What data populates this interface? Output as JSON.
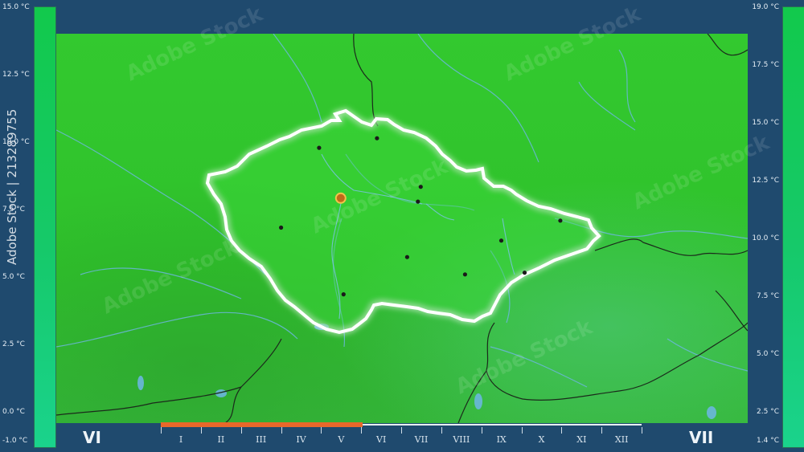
{
  "left_scale": {
    "ticks": [
      "15.0 °C",
      "12.5 °C",
      "10.0 °C",
      "7.5 °C",
      "5.0 °C",
      "2.5 °C",
      "0.0 °C",
      "-1.0 °C"
    ],
    "min": -1.0,
    "max": 15.0
  },
  "right_scale": {
    "ticks": [
      "19.0 °C",
      "17.5 °C",
      "15.0 °C",
      "12.5 °C",
      "10.0 °C",
      "7.5 °C",
      "5.0 °C",
      "2.5 °C",
      "1.4 °C"
    ],
    "min": 1.4,
    "max": 19.0
  },
  "month_left": "VI",
  "month_right": "VII",
  "timeline": {
    "months": [
      "I",
      "II",
      "III",
      "IV",
      "V",
      "VI",
      "VII",
      "VIII",
      "IX",
      "X",
      "XI",
      "XII"
    ],
    "progress_fraction": 0.42
  },
  "watermark": {
    "stock_id": "213289755",
    "brand": "Adobe Stock"
  },
  "colors": {
    "frame": "#1f4a6e",
    "map_green": "#33c92f",
    "legend_green": "#16c96a",
    "progress": "#e8682a",
    "border_glow": "#ffffff"
  },
  "cities": [
    {
      "name": "capital",
      "lon": 14.42,
      "lat": 50.08,
      "capital": true
    },
    {
      "name": "city-1",
      "lon": 13.37,
      "lat": 49.74
    },
    {
      "name": "city-2",
      "lon": 14.47,
      "lat": 48.97
    },
    {
      "name": "city-3",
      "lon": 16.61,
      "lat": 49.2
    },
    {
      "name": "city-4",
      "lon": 18.29,
      "lat": 49.82
    },
    {
      "name": "city-5",
      "lon": 17.25,
      "lat": 49.59
    },
    {
      "name": "city-6",
      "lon": 15.06,
      "lat": 50.77
    },
    {
      "name": "city-7",
      "lon": 15.83,
      "lat": 50.21
    },
    {
      "name": "city-8",
      "lon": 15.78,
      "lat": 50.04
    },
    {
      "name": "city-9",
      "lon": 14.04,
      "lat": 50.66
    },
    {
      "name": "city-10",
      "lon": 15.59,
      "lat": 49.4
    },
    {
      "name": "city-11",
      "lon": 17.66,
      "lat": 49.22
    }
  ]
}
